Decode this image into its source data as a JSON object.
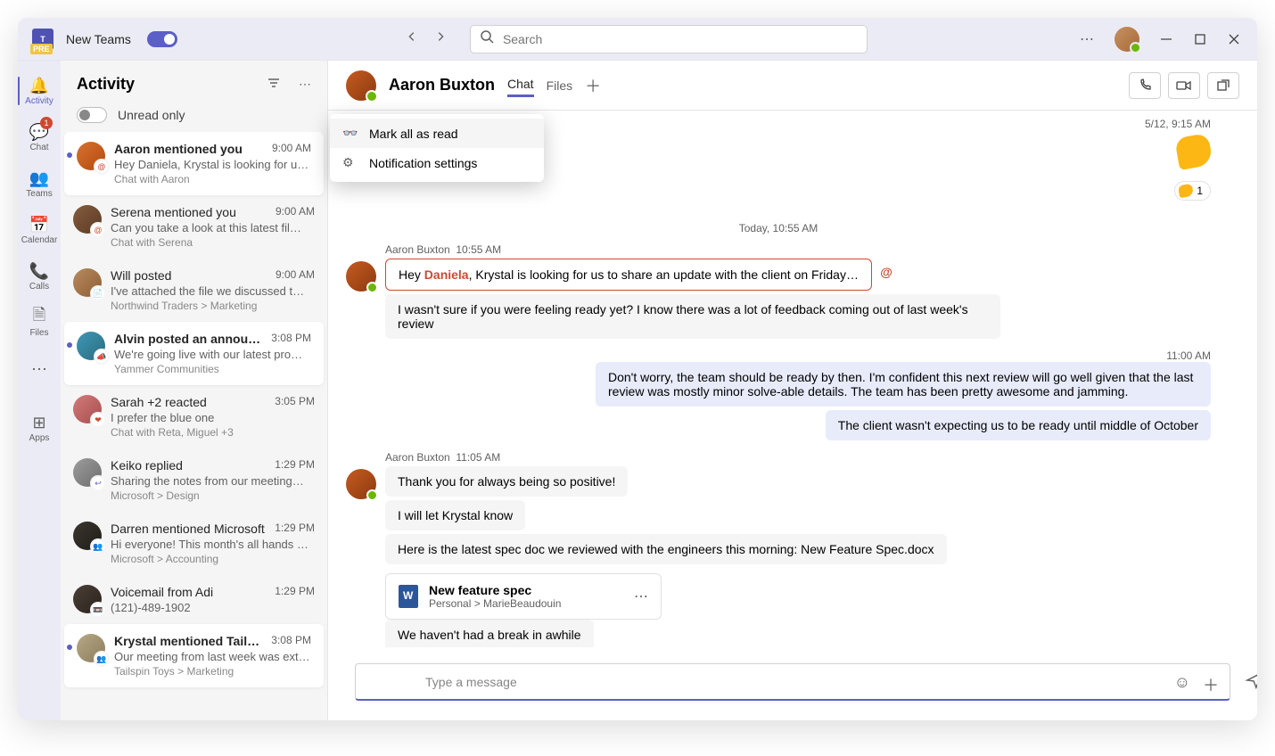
{
  "titlebar": {
    "app_name": "New Teams",
    "search_placeholder": "Search"
  },
  "rail": {
    "items": [
      {
        "key": "activity",
        "label": "Activity",
        "icon": "🔔",
        "active": true
      },
      {
        "key": "chat",
        "label": "Chat",
        "icon": "💬",
        "badge": "1"
      },
      {
        "key": "teams",
        "label": "Teams",
        "icon": "👥"
      },
      {
        "key": "calendar",
        "label": "Calendar",
        "icon": "📅"
      },
      {
        "key": "calls",
        "label": "Calls",
        "icon": "📞"
      },
      {
        "key": "files",
        "label": "Files",
        "icon": "🗎"
      },
      {
        "key": "more",
        "label": "",
        "icon": "⋯"
      },
      {
        "key": "apps",
        "label": "Apps",
        "icon": "⊞"
      }
    ]
  },
  "listpane": {
    "title": "Activity",
    "unread_label": "Unread only",
    "items": [
      {
        "title": "Aaron mentioned you",
        "time": "9:00 AM",
        "preview": "Hey Daniela, Krystal is looking for u…",
        "sub": "Chat with Aaron",
        "badge_type": "mention",
        "bold": true,
        "unread": true,
        "selected": true,
        "avatar": "av-aaron"
      },
      {
        "title": "Serena mentioned you",
        "time": "9:00 AM",
        "preview": "Can you take a look at this latest fil…",
        "sub": "Chat with Serena",
        "badge_type": "mention",
        "avatar": "av-serena"
      },
      {
        "title": "Will posted",
        "time": "9:00 AM",
        "preview": "I've attached the file we discussed t…",
        "sub": "Northwind Traders > Marketing",
        "badge_type": "post",
        "avatar": "av-will"
      },
      {
        "title": "Alvin posted an announcement",
        "time": "3:08 PM",
        "preview": "We're going live with our latest pro…",
        "sub": "Yammer Communities",
        "badge_type": "announcement",
        "bold": true,
        "unread": true,
        "avatar": "av-alvin"
      },
      {
        "title": "Sarah +2 reacted",
        "time": "3:05 PM",
        "preview": "I prefer the blue one",
        "sub": "Chat with Reta, Miguel +3",
        "badge_type": "reaction",
        "avatar": "av-sarah"
      },
      {
        "title": "Keiko replied",
        "time": "1:29 PM",
        "preview": "Sharing the notes from our meeting…",
        "sub": "Microsoft > Design",
        "badge_type": "reply",
        "avatar": "av-keiko"
      },
      {
        "title": "Darren mentioned Microsoft",
        "time": "1:29 PM",
        "preview": "Hi everyone! This month's all hands …",
        "sub": "Microsoft > Accounting",
        "badge_type": "team-mention",
        "avatar": "av-darren"
      },
      {
        "title": "Voicemail from Adi",
        "time": "1:29 PM",
        "preview": "(121)-489-1902",
        "sub": "",
        "badge_type": "voicemail",
        "avatar": "av-adi"
      },
      {
        "title": "Krystal mentioned Tailspin Toys",
        "time": "3:08 PM",
        "preview": "Our meeting from last week was ext…",
        "sub": "Tailspin Toys > Marketing",
        "badge_type": "team-mention",
        "bold": true,
        "unread": true,
        "avatar": "av-krystal"
      }
    ]
  },
  "context_menu": {
    "items": [
      {
        "icon": "👓",
        "label": "Mark all as read",
        "hover": true
      },
      {
        "icon": "⚙",
        "label": "Notification settings"
      }
    ]
  },
  "chat": {
    "header": {
      "name": "Aaron Buxton",
      "tabs": [
        {
          "key": "chat",
          "label": "Chat",
          "active": true
        },
        {
          "key": "files",
          "label": "Files"
        }
      ]
    },
    "top_time": "5/12, 9:15 AM",
    "reaction_count": "1",
    "divider": "Today, 10:55 AM",
    "groups": [
      {
        "mine": false,
        "sender": "Aaron Buxton",
        "time": "10:55 AM",
        "messages": [
          {
            "type": "mention",
            "pre": "Hey ",
            "name": "Daniela",
            "post": ", Krystal is looking for us to share an update with the client on Friday…"
          },
          {
            "type": "text",
            "text": "I wasn't sure if you were feeling ready yet? I know there was a lot of feedback coming out of last week's review"
          }
        ]
      },
      {
        "mine": true,
        "time_right": "11:00 AM",
        "messages": [
          {
            "type": "text",
            "text": "Don't worry, the team should be ready by then. I'm confident this next review will go well given that the last review was mostly minor solve-able details. The team has been pretty awesome and jamming."
          },
          {
            "type": "text",
            "text": "The client wasn't expecting us to be ready until middle of October"
          }
        ]
      },
      {
        "mine": false,
        "sender": "Aaron Buxton",
        "time": "11:05 AM",
        "messages": [
          {
            "type": "text",
            "text": "Thank you for always being so positive!"
          },
          {
            "type": "text",
            "text": "I will let Krystal know"
          },
          {
            "type": "text",
            "text": "Here is the latest spec doc we reviewed with the engineers this morning: New Feature Spec.docx"
          },
          {
            "type": "file",
            "file_name": "New feature spec",
            "file_loc": "Personal > MarieBeaudouin"
          },
          {
            "type": "text",
            "text": "We haven't had a break in awhile"
          }
        ]
      }
    ],
    "compose_placeholder": "Type a message"
  },
  "badge_icons": {
    "mention": "@",
    "post": "📄",
    "announcement": "📣",
    "reaction": "❤",
    "reply": "↩",
    "team-mention": "👥",
    "voicemail": "📼"
  },
  "badge_colors": {
    "mention": "#cc4a31",
    "post": "#5b5fc7",
    "announcement": "#5b5fc7",
    "reaction": "#cc4a31",
    "reply": "#5b5fc7",
    "team-mention": "#cc4a31",
    "voicemail": "#5b5fc7"
  }
}
